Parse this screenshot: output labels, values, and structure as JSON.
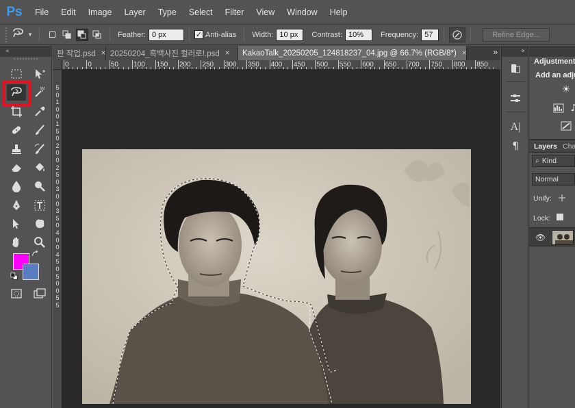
{
  "app": {
    "logo": "Ps"
  },
  "menu": [
    "File",
    "Edit",
    "Image",
    "Layer",
    "Type",
    "Select",
    "Filter",
    "View",
    "Window",
    "Help"
  ],
  "options": {
    "feather_label": "Feather:",
    "feather_value": "0 px",
    "antialias_label": "Anti-alias",
    "antialias_checked": true,
    "width_label": "Width:",
    "width_value": "10 px",
    "contrast_label": "Contrast:",
    "contrast_value": "10%",
    "frequency_label": "Frequency:",
    "frequency_value": "57",
    "refine_edge_label": "Refine Edge..."
  },
  "panels_collapse": "«",
  "tabs": [
    {
      "label": "판 작업.psd",
      "active": false
    },
    {
      "label": "20250204_흑백사진 컬러로!.psd",
      "active": false
    },
    {
      "label": "KakaoTalk_20250205_124818237_04.jpg @ 66.7% (RGB/8*)",
      "active": true
    }
  ],
  "tabs_overflow": "»",
  "ruler": {
    "top_labels": [
      "0",
      "0",
      "50",
      "100",
      "150",
      "200",
      "250",
      "300",
      "350",
      "400",
      "450",
      "500",
      "550",
      "600",
      "650",
      "700",
      "750",
      "800",
      "850"
    ],
    "left_labels": [
      "5",
      "0",
      "1",
      "0",
      "0",
      "1",
      "5",
      "0",
      "2",
      "0",
      "0",
      "2",
      "5",
      "0",
      "3",
      "0",
      "0",
      "3",
      "5",
      "0",
      "4",
      "0",
      "0",
      "4",
      "5",
      "0",
      "5",
      "0",
      "0",
      "5",
      "5"
    ]
  },
  "tools": {
    "selected": "magnetic-lasso-tool",
    "foreground_color": "#ff00ff",
    "background_color": "#5a7cc0"
  },
  "highlight_color": "#e8101e",
  "right_panel": {
    "adjustments_title": "Adjustments",
    "adjustments_hint": "Add an adju",
    "layers_tab": "Layers",
    "channels_tab": "Cha",
    "kind_label": "Kind",
    "blend_mode": "Normal",
    "unify_label": "Unify:",
    "lock_label": "Lock:"
  }
}
